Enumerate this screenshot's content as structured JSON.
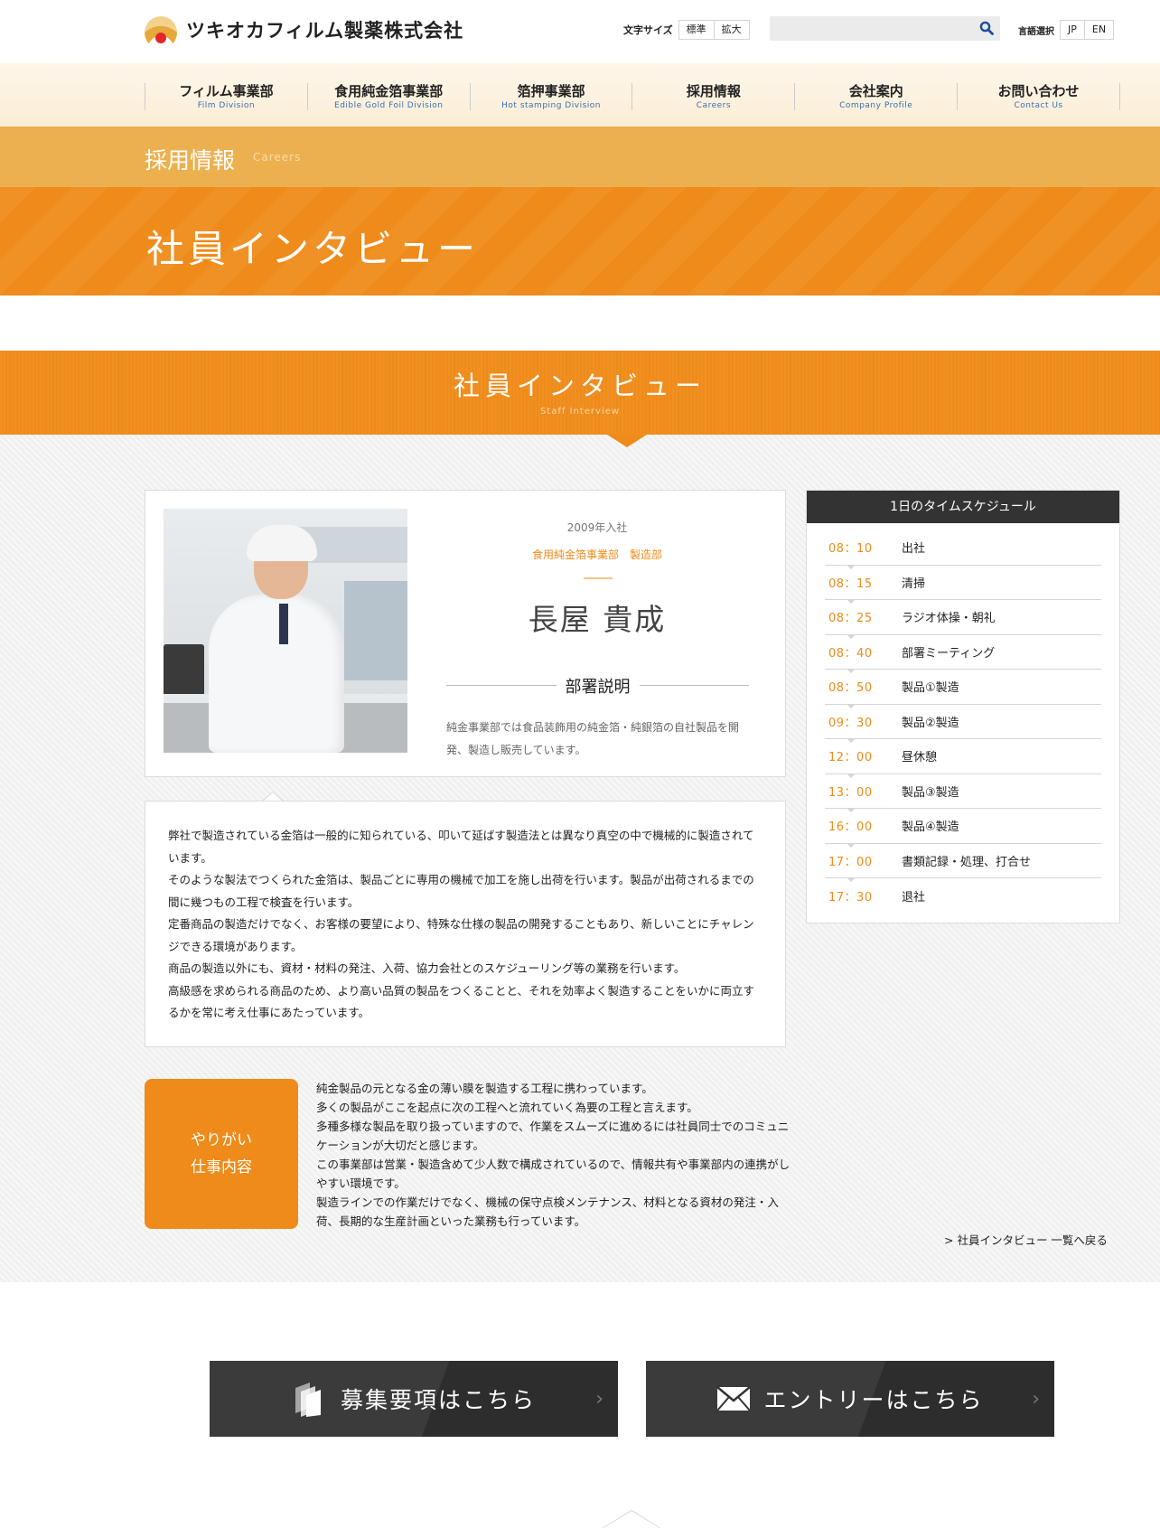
{
  "header": {
    "logo_text": "ツキオカフィルム製薬株式会社",
    "fontsize_label": "文字サイズ",
    "fontsize_standard": "標準",
    "fontsize_large": "拡大",
    "search_placeholder": "",
    "lang_label": "言語選択",
    "lang_jp": "JP",
    "lang_en": "EN"
  },
  "nav": [
    {
      "jp": "フィルム事業部",
      "en": "Film Division"
    },
    {
      "jp": "食用純金箔事業部",
      "en": "Edible Gold Foil Division"
    },
    {
      "jp": "箔押事業部",
      "en": "Hot stamping Division"
    },
    {
      "jp": "採用情報",
      "en": "Careers"
    },
    {
      "jp": "会社案内",
      "en": "Company Profile"
    },
    {
      "jp": "お問い合わせ",
      "en": "Contact Us"
    }
  ],
  "category": {
    "jp": "採用情報",
    "en": "Careers"
  },
  "page_title": "社員インタビュー",
  "section": {
    "jp": "社員インタビュー",
    "en": "Staff Interview"
  },
  "profile": {
    "year": "2009年入社",
    "dept": "食用純金箔事業部　製造部",
    "name": "長屋 貴成",
    "dept_heading": "部署説明",
    "dept_desc": "純金事業部では食品装飾用の純金箔・純銀箔の自社製品を開発、製造し販売しています。"
  },
  "story": [
    "弊社で製造されている金箔は一般的に知られている、叩いて延ばす製造法とは異なり真空の中で機械的に製造されています。",
    "そのような製法でつくられた金箔は、製品ごとに専用の機械で加工を施し出荷を行います。製品が出荷されるまでの間に幾つもの工程で検査を行います。",
    "定番商品の製造だけでなく、お客様の要望により、特殊な仕様の製品の開発することもあり、新しいことにチャレンジできる環境があります。",
    "商品の製造以外にも、資材・材料の発注、入荷、協力会社とのスケジューリング等の業務を行います。",
    "高級感を求められる商品のため、より高い品質の製品をつくることと、それを効率よく製造することをいかに両立するかを常に考え仕事にあたっています。"
  ],
  "tag": {
    "line1": "やりがい",
    "line2": "仕事内容"
  },
  "tag_text": [
    "純金製品の元となる金の薄い膜を製造する工程に携わっています。",
    "多くの製品がここを起点に次の工程へと流れていく為要の工程と言えます。",
    "多種多様な製品を取り扱っていますので、作業をスムーズに進めるには社員同士でのコミュニケーションが大切だと感じます。",
    "この事業部は営業・製造含めて少人数で構成されているので、情報共有や事業部内の連携がしやすい環境です。",
    "製造ラインでの作業だけでなく、機械の保守点検メンテナンス、材料となる資材の発注・入荷、長期的な生産計画といった業務も行っています。"
  ],
  "back_link": "> 社員インタビュー 一覧へ戻る",
  "schedule": {
    "title": "1日のタイムスケジュール",
    "items": [
      {
        "time": "08：10",
        "event": "出社"
      },
      {
        "time": "08：15",
        "event": "清掃"
      },
      {
        "time": "08：25",
        "event": "ラジオ体操・朝礼"
      },
      {
        "time": "08：40",
        "event": "部署ミーティング"
      },
      {
        "time": "08：50",
        "event": "製品①製造"
      },
      {
        "time": "09：30",
        "event": "製品②製造"
      },
      {
        "time": "12：00",
        "event": "昼休憩"
      },
      {
        "time": "13：00",
        "event": "製品③製造"
      },
      {
        "time": "16：00",
        "event": "製品④製造"
      },
      {
        "time": "17：00",
        "event": "書類記録・処理、打合せ"
      },
      {
        "time": "17：30",
        "event": "退社"
      }
    ]
  },
  "cta": {
    "recruit": "募集要項はこちら",
    "entry": "エントリーはこちら"
  },
  "colors": {
    "accent": "#ef8b1a",
    "band": "#edb04f",
    "dark": "#333333",
    "nav_en": "#3a6fb0"
  },
  "icons": [
    "search-icon",
    "documents-icon",
    "envelope-icon",
    "chevron-right-icon",
    "page-top-icon"
  ]
}
